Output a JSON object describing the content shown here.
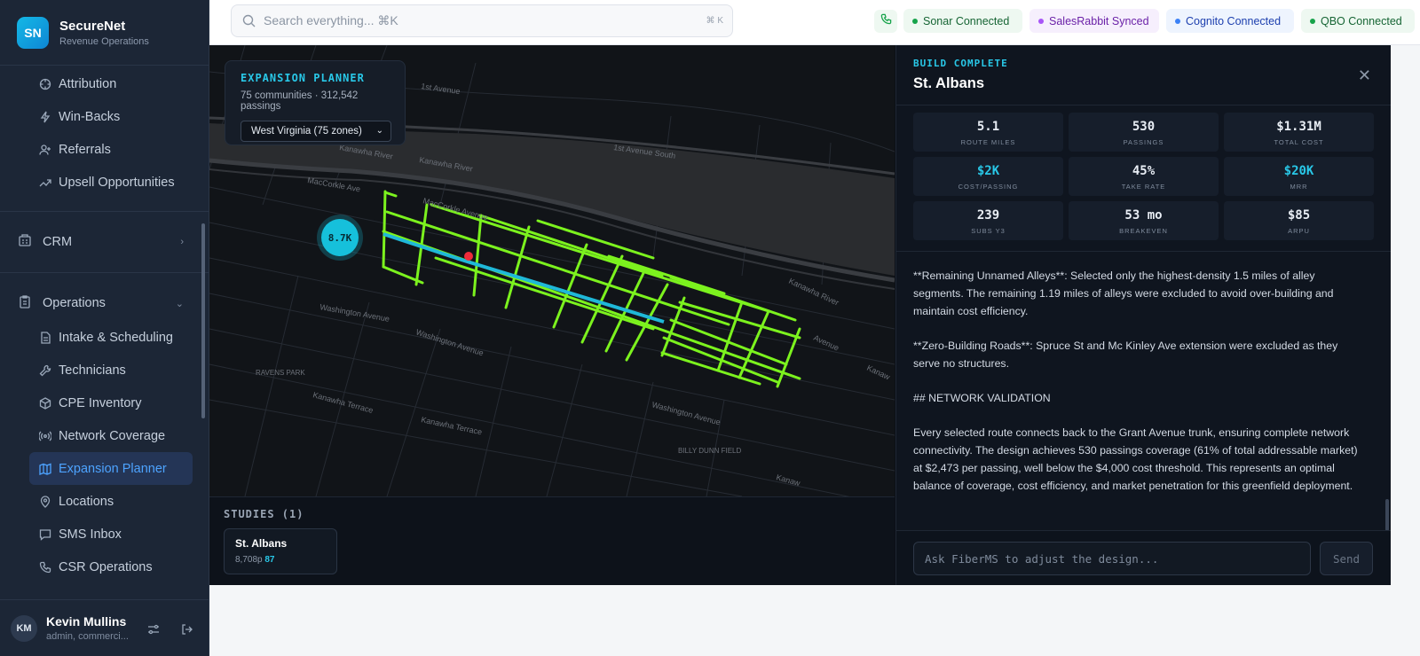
{
  "brand": {
    "initials": "SN",
    "name": "SecureNet",
    "subtitle": "Revenue Operations"
  },
  "sidebar": {
    "top_items": [
      {
        "label": "Attribution",
        "icon": "target-icon"
      },
      {
        "label": "Win-Backs",
        "icon": "bolt-icon"
      },
      {
        "label": "Referrals",
        "icon": "user-plus-icon"
      },
      {
        "label": "Upsell Opportunities",
        "icon": "trending-up-icon"
      }
    ],
    "crm": {
      "label": "CRM",
      "icon": "building-icon"
    },
    "operations": {
      "label": "Operations",
      "icon": "clipboard-icon",
      "items": [
        {
          "label": "Intake & Scheduling",
          "icon": "document-icon"
        },
        {
          "label": "Technicians",
          "icon": "wrench-icon"
        },
        {
          "label": "CPE Inventory",
          "icon": "package-icon"
        },
        {
          "label": "Network Coverage",
          "icon": "radio-icon"
        },
        {
          "label": "Expansion Planner",
          "icon": "map-icon",
          "active": true
        },
        {
          "label": "Locations",
          "icon": "pin-icon"
        },
        {
          "label": "SMS Inbox",
          "icon": "message-icon"
        },
        {
          "label": "CSR Operations",
          "icon": "phone-icon"
        }
      ]
    }
  },
  "user": {
    "initials": "KM",
    "name": "Kevin Mullins",
    "role": "admin, commerci..."
  },
  "topbar": {
    "search_placeholder": "Search everything... ⌘K",
    "search_kbd": "⌘ K",
    "statuses": [
      {
        "label": "Sonar Connected",
        "color": "#16a34a",
        "bg": "#eef8f1",
        "text": "#166534"
      },
      {
        "label": "SalesRabbit Synced",
        "color": "#a855f7",
        "bg": "#f6effd",
        "text": "#6b21a8"
      },
      {
        "label": "Cognito Connected",
        "color": "#3b82f6",
        "bg": "#eef4fe",
        "text": "#1e40af"
      },
      {
        "label": "QBO Connected",
        "color": "#16a34a",
        "bg": "#eef8f1",
        "text": "#166534"
      }
    ]
  },
  "map": {
    "planner_title": "EXPANSION PLANNER",
    "planner_sub": "75 communities · 312,542 passings",
    "region_select": "West Virginia (75 zones)",
    "bubble_label": "8.7K",
    "labels": {
      "river1": "Kanawha River",
      "river2": "Kanawha River",
      "river3": "Kanawha River",
      "macc1": "MacCorkle Ave",
      "macc2": "MacCorkle Avenue",
      "first_ave": "1st Avenue",
      "first_ave_south": "1st Avenue South",
      "wash1": "Washington Avenue",
      "wash2": "Washington Avenue",
      "wash3": "Washington Avenue",
      "ravens": "RAVENS PARK",
      "terrace1": "Kanawha Terrace",
      "terrace2": "Kanawha Terrace",
      "dunn": "BILLY DUNN FIELD",
      "kanawha_edge": "Kanaw",
      "avenue_edge": "Avenue",
      "kanawha_edge2": "Kanaw"
    },
    "colors": {
      "build": "#7cf21e",
      "trunk": "#1fb8d8",
      "marker": "#ef2b3a"
    }
  },
  "studies": {
    "title": "STUDIES (1)",
    "items": [
      {
        "name": "St. Albans",
        "passings": "8,708p",
        "score": "87"
      }
    ]
  },
  "panel": {
    "kicker": "BUILD COMPLETE",
    "title": "St. Albans",
    "metrics": [
      {
        "value": "5.1",
        "label": "ROUTE MILES",
        "accent": false
      },
      {
        "value": "530",
        "label": "PASSINGS",
        "accent": false
      },
      {
        "value": "$1.31M",
        "label": "TOTAL COST",
        "accent": false
      },
      {
        "value": "$2K",
        "label": "COST/PASSING",
        "accent": true
      },
      {
        "value": "45%",
        "label": "TAKE RATE",
        "accent": false
      },
      {
        "value": "$20K",
        "label": "MRR",
        "accent": true
      },
      {
        "value": "239",
        "label": "SUBS Y3",
        "accent": false
      },
      {
        "value": "53 mo",
        "label": "BREAKEVEN",
        "accent": false
      },
      {
        "value": "$85",
        "label": "ARPU",
        "accent": false
      }
    ],
    "notes": [
      "**Remaining Unnamed Alleys**: Selected only the highest-density 1.5 miles of alley segments. The remaining 1.19 miles of alleys were excluded to avoid over-building and maintain cost efficiency.",
      "**Zero-Building Roads**: Spruce St and Mc Kinley Ave extension were excluded as they serve no structures.",
      "## NETWORK VALIDATION",
      "Every selected route connects back to the Grant Avenue trunk, ensuring complete network connectivity. The design achieves 530 passings coverage (61% of total addressable market) at $2,473 per passing, well below the $4,000 cost threshold. This represents an optimal balance of coverage, cost efficiency, and market penetration for this greenfield deployment."
    ],
    "chat_placeholder": "Ask FiberMS to adjust the design...",
    "send_label": "Send"
  }
}
